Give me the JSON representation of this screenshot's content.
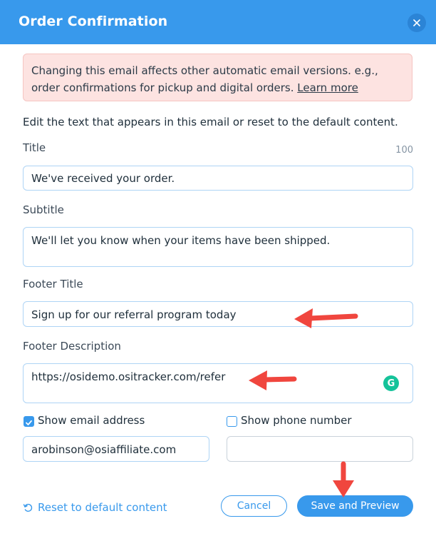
{
  "dialog": {
    "title": "Order Confirmation",
    "close_icon": "close-icon"
  },
  "alert": {
    "text": "Changing this email affects other automatic email versions. e.g., order confirmations for pickup and digital orders.",
    "link": "Learn more"
  },
  "intro": "Edit the text that appears in this email or reset to the default content.",
  "fields": {
    "title": {
      "label": "Title",
      "counter": "100",
      "value": "We've received your order."
    },
    "subtitle": {
      "label": "Subtitle",
      "value": "We'll let you know when your items have been shipped."
    },
    "footer_title": {
      "label": "Footer Title",
      "value": "Sign up for our referral program today"
    },
    "footer_description": {
      "label": "Footer Description",
      "value": "https://osidemo.ositracker.com/refer"
    }
  },
  "contact": {
    "show_email": {
      "label": "Show email address",
      "checked": true,
      "value": "arobinson@osiaffiliate.com"
    },
    "show_phone": {
      "label": "Show phone number",
      "checked": false,
      "value": ""
    }
  },
  "actions": {
    "reset": "Reset to default content",
    "cancel": "Cancel",
    "save": "Save and Preview"
  },
  "colors": {
    "accent": "#3899ec",
    "alert_bg": "#fde3e1",
    "annotation_arrow": "#f0463e"
  }
}
